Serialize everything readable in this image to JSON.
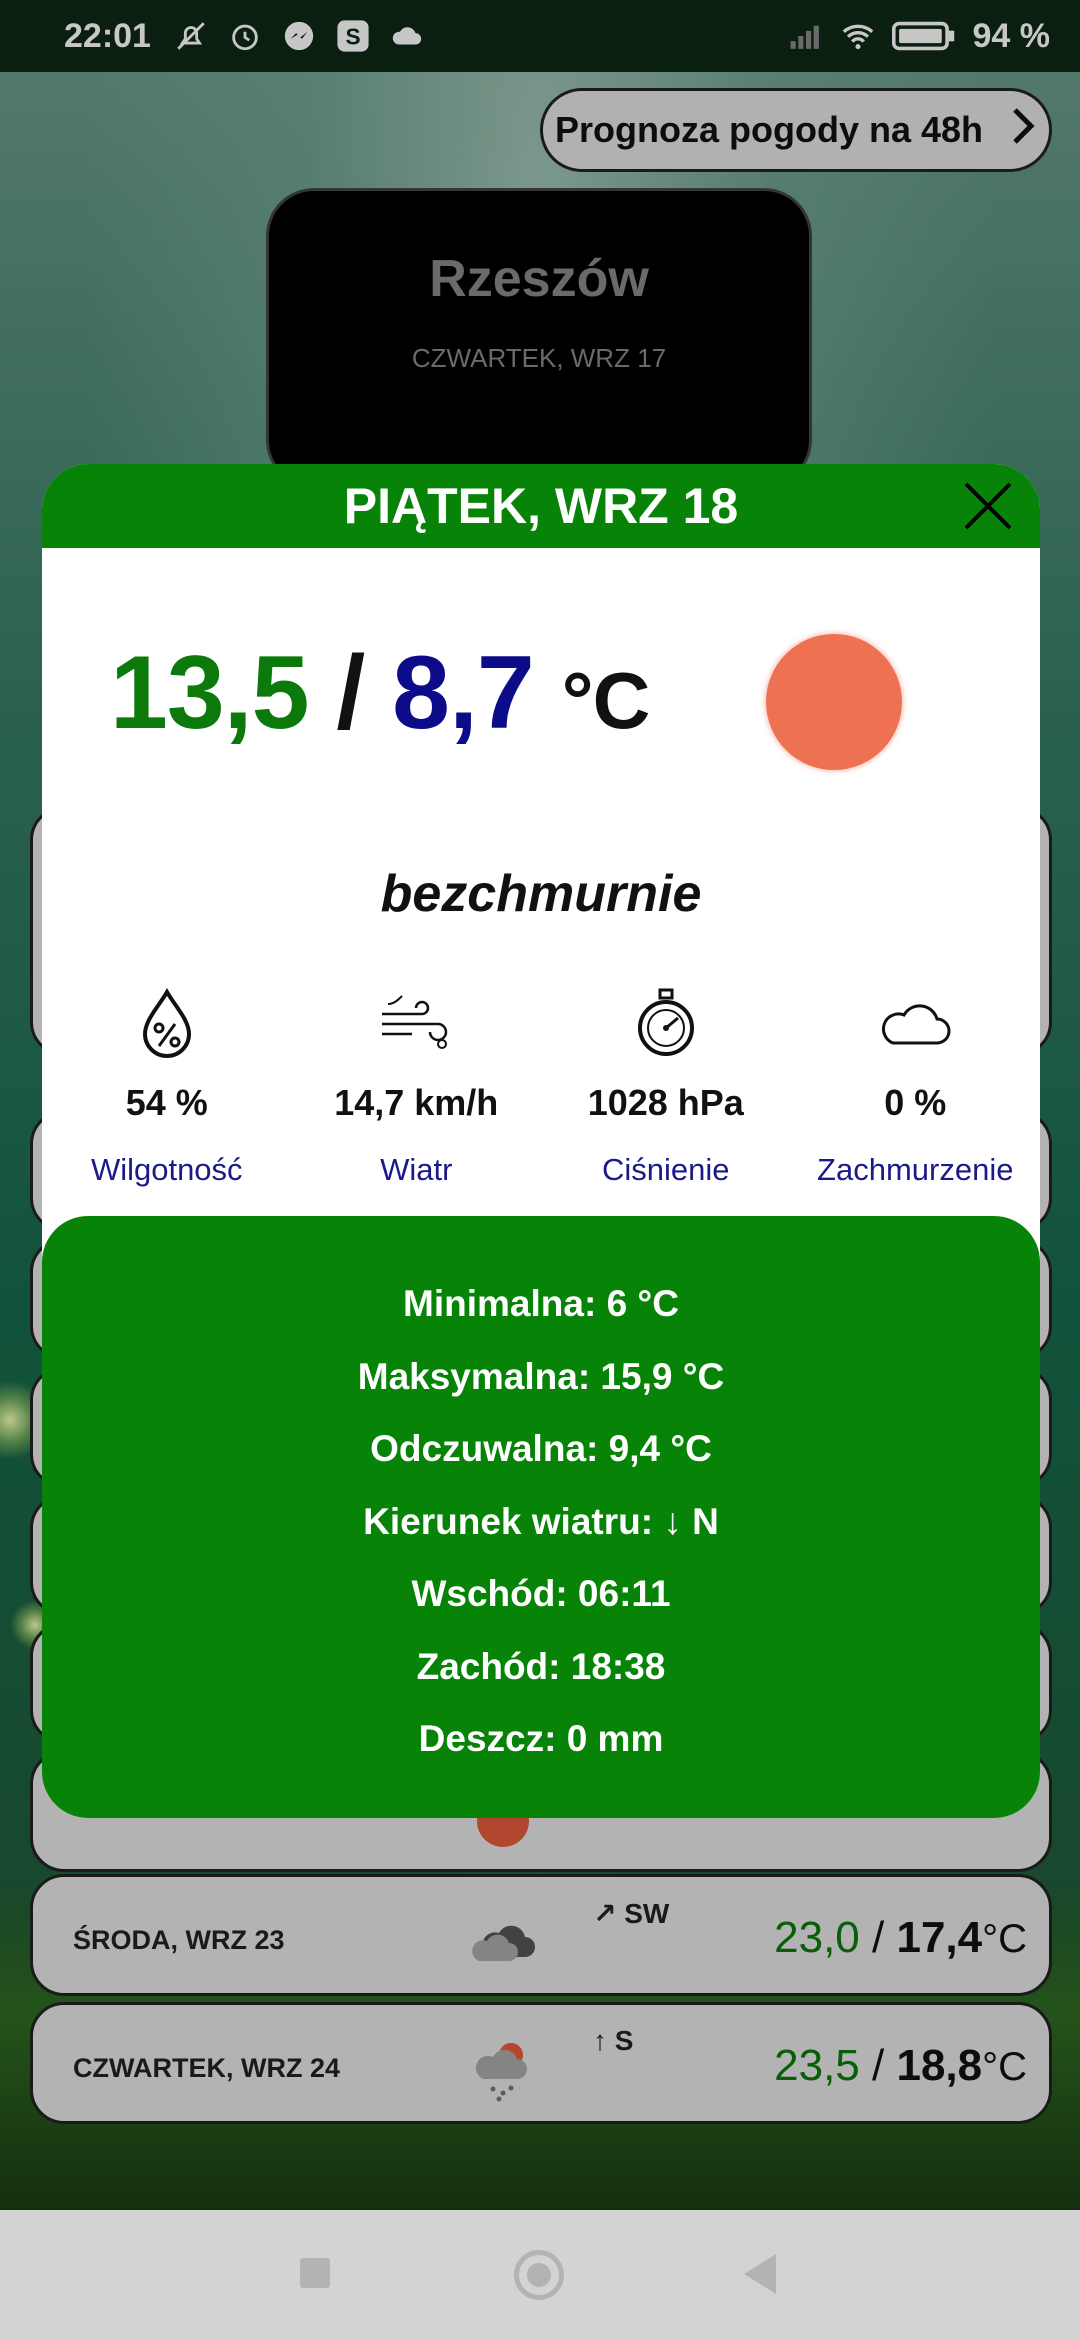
{
  "status_bar": {
    "time": "22:01",
    "battery": "94",
    "icons": [
      "mute-icon",
      "alarm-icon",
      "messenger-icon",
      "app-s-icon",
      "cloud-icon",
      "signal-icon",
      "wifi-icon",
      "battery-icon"
    ]
  },
  "header_button": {
    "label": "Prognoza pogody na 48h"
  },
  "city_card": {
    "city": "Rzeszów",
    "date": "CZWARTEK, WRZ 17"
  },
  "rows": [
    {
      "day": "ŚRODA, WRZ 23",
      "wind": "↗ SW",
      "icon": "cloudy-icon",
      "hi": "23,0",
      "lo": "17,4",
      "unit": "°C"
    },
    {
      "day": "CZWARTEK, WRZ 24",
      "wind": "↑ S",
      "icon": "rain-icon",
      "hi": "23,5",
      "lo": "18,8",
      "unit": "°C"
    }
  ],
  "modal": {
    "title": "PIĄTEK, WRZ 18",
    "temp_hi": "13,5",
    "temp_sep": " / ",
    "temp_lo": "8,7",
    "temp_unit": "°C",
    "description": "bezchmurnie",
    "metrics": [
      {
        "icon": "humidity-icon",
        "value": "54 %",
        "label": "Wilgotność"
      },
      {
        "icon": "wind-icon",
        "value": "14,7 km/h",
        "label": "Wiatr"
      },
      {
        "icon": "pressure-gauge-icon",
        "value": "1028 hPa",
        "label": "Ciśnienie"
      },
      {
        "icon": "cloud-cover-icon",
        "value": "0 %",
        "label": "Zachmurzenie"
      }
    ],
    "details": [
      "Minimalna: 6 °C",
      "Maksymalna: 15,9 °C",
      "Odczuwalna: 9,4 °C",
      "Kierunek wiatru: ↓ N",
      "Wschód: 06:11",
      "Zachód: 18:38",
      "Deszcz: 0 mm"
    ]
  },
  "colors": {
    "accent_green": "#078407",
    "temp_high": "#0b7a0b",
    "temp_low": "#0c0c8a",
    "sun": "#ee7252",
    "label_blue": "#1a1a8a"
  }
}
